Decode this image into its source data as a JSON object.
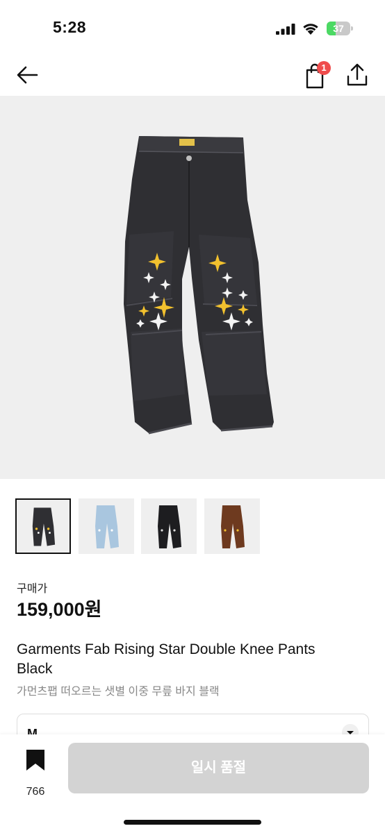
{
  "status_bar": {
    "time": "5:28",
    "battery_level": "37",
    "battery_fraction": 0.37,
    "icons": [
      "signal-icon",
      "wifi-icon",
      "battery-icon"
    ]
  },
  "nav": {
    "icons": [
      "back-arrow-icon",
      "shopping-bag-icon",
      "share-icon"
    ],
    "cart_badge": "1"
  },
  "product": {
    "price_label": "구매가",
    "price": "159,000원",
    "title_en": "Garments Fab Rising Star Double Knee Pants Black",
    "title_ko": "가먼츠팹 떠오르는 샛별 이중 무릎 바지 블랙",
    "thumbnails": [
      {
        "name": "black-denim",
        "selected": true
      },
      {
        "name": "light-blue-denim",
        "selected": false
      },
      {
        "name": "black-with-light-stars",
        "selected": false
      },
      {
        "name": "brown",
        "selected": false
      }
    ]
  },
  "size_select": {
    "selected": "M"
  },
  "bottom_bar": {
    "bookmark_count": "766",
    "soldout_label": "일시 품절"
  },
  "colors": {
    "badge": "#ef4c4c",
    "soldout_button": "#d3d3d3",
    "battery_fill": "#4cd964",
    "hero_background": "#efefef",
    "star_gold": "#f2c12e",
    "star_white": "#f4f4f4"
  }
}
